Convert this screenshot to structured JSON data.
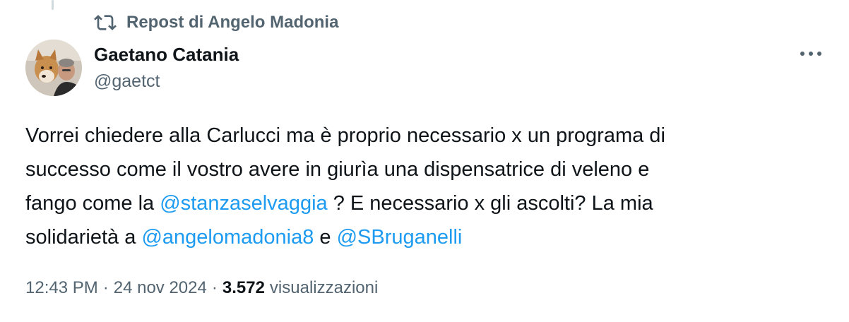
{
  "repost": {
    "label": "Repost di Angelo Madonia",
    "icon": "repost-icon"
  },
  "author": {
    "display_name": "Gaetano Catania",
    "handle": "@gaetct",
    "avatar": "avatar"
  },
  "menu": {
    "icon": "more-icon"
  },
  "tweet": {
    "line1": "Vorrei chiedere alla Carlucci ma è proprio necessario x un programa di",
    "line2": "successo come il vostro avere in giurìa una dispensatrice di veleno e",
    "line3_pre": "fango come la ",
    "mention1": "@stanzaselvaggia",
    "line3_post": " ? E necessario x gli ascolti? La mia",
    "line4_pre": "solidarietà a ",
    "mention2": "@angelomadonia8",
    "line4_mid": " e ",
    "mention3": "@SBruganelli"
  },
  "meta": {
    "time": "12:43 PM",
    "separator": "·",
    "date": "24 nov 2024",
    "views_count": "3.572",
    "views_label": "visualizzazioni"
  },
  "colors": {
    "text": "#0f1419",
    "secondary": "#536471",
    "link": "#1d9bf0",
    "thread_line": "#cfd9de"
  }
}
